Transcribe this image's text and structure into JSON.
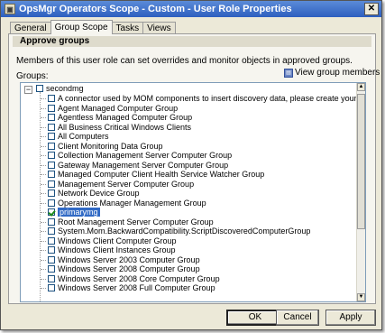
{
  "window": {
    "title": "OpsMgr Operators Scope - Custom - User Role Properties",
    "close_glyph": "✕"
  },
  "tabs": [
    {
      "label": "General",
      "active": false
    },
    {
      "label": "Group Scope",
      "active": true
    },
    {
      "label": "Tasks",
      "active": false
    },
    {
      "label": "Views",
      "active": false
    }
  ],
  "panel": {
    "section_header": "Approve groups",
    "description": "Members of this user role can set overrides and monitor objects in approved groups.",
    "groups_label": "Groups:",
    "view_members_label": "View group members"
  },
  "tree": {
    "root": {
      "label": "secondmg",
      "expanded": true,
      "checked": false
    },
    "items": [
      {
        "label": "A connector used by MOM components to insert discovery data, please create your own connector do not use",
        "checked": false,
        "selected": false
      },
      {
        "label": "Agent Managed Computer Group",
        "checked": false,
        "selected": false
      },
      {
        "label": "Agentless Managed Computer Group",
        "checked": false,
        "selected": false
      },
      {
        "label": "All Business Critical Windows Clients",
        "checked": false,
        "selected": false
      },
      {
        "label": "All Computers",
        "checked": false,
        "selected": false
      },
      {
        "label": "Client Monitoring Data Group",
        "checked": false,
        "selected": false
      },
      {
        "label": "Collection Management Server Computer Group",
        "checked": false,
        "selected": false
      },
      {
        "label": "Gateway Management Server Computer Group",
        "checked": false,
        "selected": false
      },
      {
        "label": "Managed Computer Client Health Service Watcher Group",
        "checked": false,
        "selected": false
      },
      {
        "label": "Management Server Computer Group",
        "checked": false,
        "selected": false
      },
      {
        "label": "Network Device Group",
        "checked": false,
        "selected": false
      },
      {
        "label": "Operations Manager Management Group",
        "checked": false,
        "selected": false
      },
      {
        "label": "primarymg",
        "checked": true,
        "selected": true
      },
      {
        "label": "Root Management Server Computer Group",
        "checked": false,
        "selected": false
      },
      {
        "label": "System.Mom.BackwardCompatibility.ScriptDiscoveredComputerGroup",
        "checked": false,
        "selected": false
      },
      {
        "label": "Windows Client Computer Group",
        "checked": false,
        "selected": false
      },
      {
        "label": "Windows Client Instances Group",
        "checked": false,
        "selected": false
      },
      {
        "label": "Windows Server 2003 Computer Group",
        "checked": false,
        "selected": false
      },
      {
        "label": "Windows Server 2008 Computer Group",
        "checked": false,
        "selected": false
      },
      {
        "label": "Windows Server 2008 Core Computer Group",
        "checked": false,
        "selected": false
      },
      {
        "label": "Windows Server 2008 Full Computer Group",
        "checked": false,
        "selected": false
      }
    ]
  },
  "buttons": {
    "ok": "OK",
    "cancel": "Cancel",
    "apply": "Apply"
  }
}
